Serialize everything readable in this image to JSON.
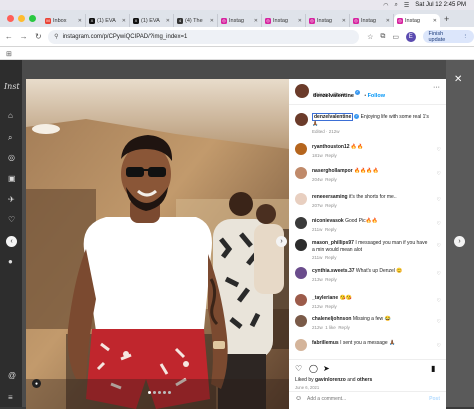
{
  "menubar": {
    "datetime": "Sat Jul 12  2:45 PM"
  },
  "tabs": [
    {
      "label": "Inbox",
      "favicon_color": "#ea4335",
      "favicon_glyph": "M"
    },
    {
      "label": "(1) EVA",
      "favicon_color": "#111111",
      "favicon_glyph": "X"
    },
    {
      "label": "(1) EVA",
      "favicon_color": "#111111",
      "favicon_glyph": "X"
    },
    {
      "label": "(4) The",
      "favicon_color": "#333333",
      "favicon_glyph": "4"
    },
    {
      "label": "Instag",
      "favicon_color": "#d6249f",
      "favicon_glyph": "◎"
    },
    {
      "label": "Instag",
      "favicon_color": "#d6249f",
      "favicon_glyph": "◎"
    },
    {
      "label": "Instag",
      "favicon_color": "#d6249f",
      "favicon_glyph": "◎"
    },
    {
      "label": "Instag",
      "favicon_color": "#d6249f",
      "favicon_glyph": "◎"
    },
    {
      "label": "Instag",
      "favicon_color": "#d6249f",
      "favicon_glyph": "◎",
      "active": true
    }
  ],
  "address": {
    "url": "instagram.com/p/CPywiQCIPAD/?img_index=1"
  },
  "toolbar": {
    "profile_initial": "E",
    "finish_update": "Finish update"
  },
  "post": {
    "username": "denzelvalentine",
    "follow": "Follow",
    "location": "Chicago, Illinois",
    "caption_user": "denzelvalentine",
    "caption_text": "Enjoying life with some real 1's 🙏🏾",
    "caption_meta": "Edited · 212w",
    "comments": [
      {
        "user": "ryanthouston12",
        "text": "🔥🔥",
        "time": "181w",
        "reply": "Reply"
      },
      {
        "user": "naserghollampor",
        "text": "🔥🔥🔥🔥",
        "time": "204w",
        "reply": "Reply"
      },
      {
        "user": "reneeersaming",
        "text": "it's the shorts for me..",
        "time": "207w",
        "reply": "Reply"
      },
      {
        "user": "niconievasok",
        "text": "Good Pic🔥🔥",
        "time": "211w",
        "reply": "Reply"
      },
      {
        "user": "mason_phillips97",
        "text": "I messaged you man if you have a min would mean alot",
        "time": "211w",
        "reply": "Reply"
      },
      {
        "user": "cynthia.sweets.37",
        "text": "What's up Denzel 😊",
        "time": "213w",
        "reply": "Reply"
      },
      {
        "user": "_tayleriane",
        "text": "😘😘",
        "time": "212w",
        "reply": "Reply"
      },
      {
        "user": "chaleneljohnson",
        "text": "Missing a few 😂",
        "time": "212w",
        "likes": "1 like",
        "reply": "Reply"
      },
      {
        "user": "fabrillemus",
        "text": "I sent you a message 🙏🏾",
        "time": "",
        "reply": ""
      }
    ],
    "liked_by_prefix": "Liked by",
    "liked_by_user": "gavinlorenzo",
    "liked_by_and": "and",
    "liked_by_others": "others",
    "date": "June 6, 2021",
    "add_comment_placeholder": "Add a comment...",
    "post_button": "Post"
  }
}
